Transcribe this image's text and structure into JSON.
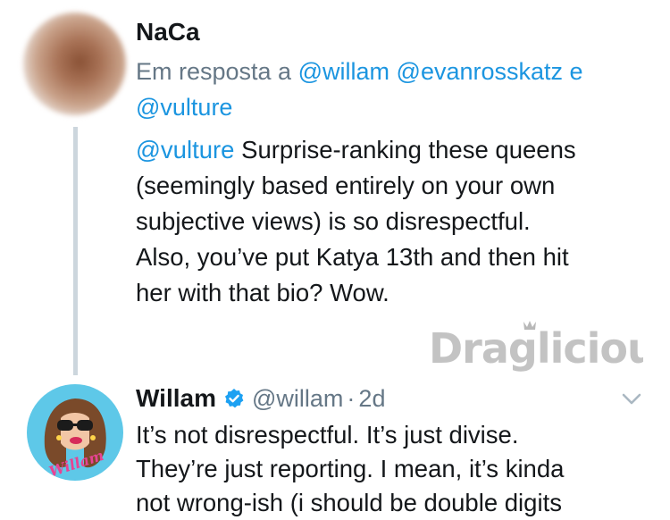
{
  "tweet1": {
    "author_name": "NaCa",
    "reply_prefix": "Em resposta a",
    "reply_mentions": [
      "@willam",
      "@evanrosskatz",
      "@vulture"
    ],
    "reply_joiner": "e",
    "body_mention": "@vulture",
    "body_lines": [
      " Surprise-ranking these queens",
      "(seemingly based entirely on your own",
      "subjective views) is so disrespectful.",
      "Also, you’ve put Katya 13th and then hit",
      "her with that bio? Wow."
    ]
  },
  "watermark": {
    "text": "Draglicious"
  },
  "tweet2": {
    "author_name": "Willam",
    "handle": "@willam",
    "separator": "·",
    "time": "2d",
    "body_lines": [
      "It’s not disrespectful. It’s just divise.",
      "They’re just reporting. I mean, it’s kinda",
      "not wrong-ish (i should be double digits"
    ],
    "avatar_text": "Willam"
  },
  "icons": {
    "verified": "verified-badge-icon",
    "more": "chevron-down-icon"
  },
  "colors": {
    "link": "#1b95e0",
    "muted": "#657786",
    "thread_line": "#ccd6dd",
    "verified": "#1da1f2",
    "avatar2_bg": "#5ec8e8",
    "avatar2_signature": "#e84393"
  }
}
